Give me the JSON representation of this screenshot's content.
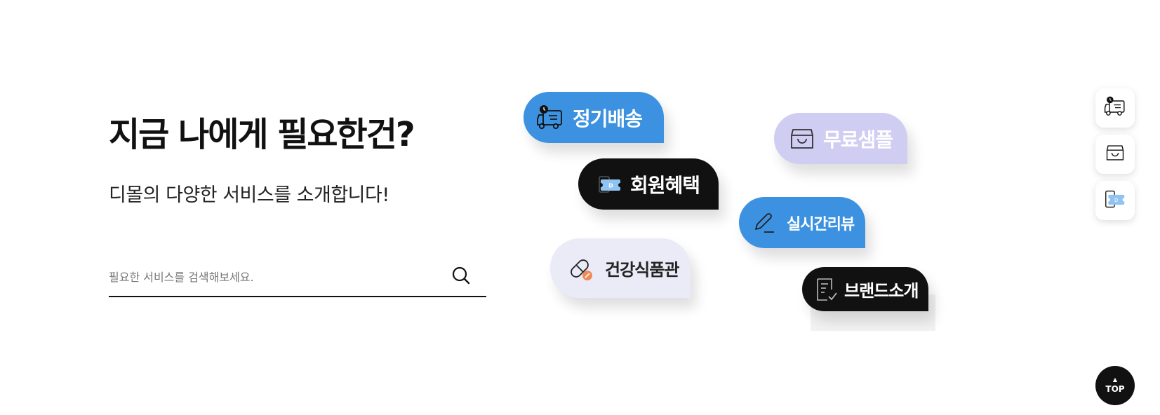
{
  "hero": {
    "title": "지금 나에게 필요한건?",
    "subtitle": "디몰의 다양한 서비스를 소개합니다!"
  },
  "search": {
    "placeholder": "필요한 서비스를 검색해보세요.",
    "value": "",
    "icon": "search-icon"
  },
  "services": [
    {
      "label": "정기배송",
      "icon": "delivery-truck-icon",
      "color": "#3c92e0"
    },
    {
      "label": "회원혜택",
      "icon": "coupon-icon",
      "color": "#111111"
    },
    {
      "label": "건강식품관",
      "icon": "pill-icon",
      "color": "#ebebf7"
    },
    {
      "label": "무료샘플",
      "icon": "shopping-bag-icon",
      "color": "#cfcdf2"
    },
    {
      "label": "실시간리뷰",
      "icon": "pencil-icon",
      "color": "#3c92e0"
    },
    {
      "label": "브랜드소개",
      "icon": "checklist-document-icon",
      "color": "#111111"
    }
  ],
  "quick_menu": [
    {
      "icon": "delivery-truck-icon"
    },
    {
      "icon": "shopping-bag-icon"
    },
    {
      "icon": "mobile-coupon-icon"
    }
  ],
  "top_button": {
    "label": "TOP",
    "icon": "arrow-up-icon"
  }
}
